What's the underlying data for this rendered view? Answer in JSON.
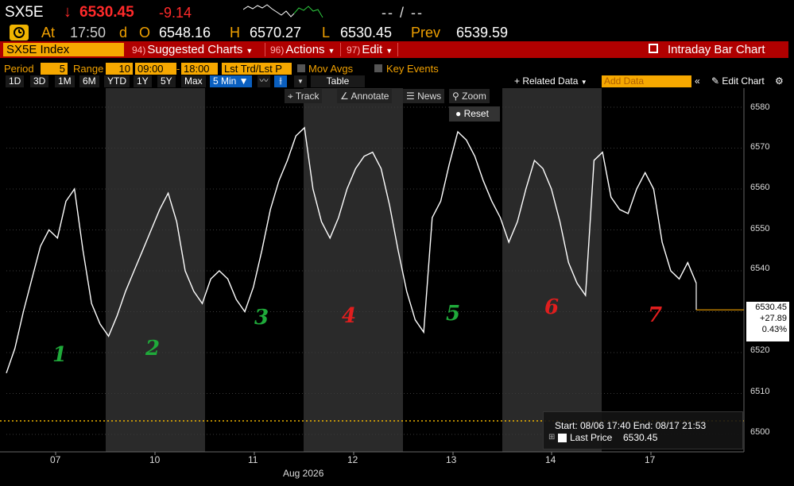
{
  "header": {
    "ticker": "SX5E",
    "arrow": "↓",
    "last_price": "6530.45",
    "net_change": "-9.14",
    "dashes": "-- / --",
    "at_label": "At",
    "time": "17:50",
    "d_label": "d",
    "open_label": "O",
    "open": "6548.16",
    "high_label": "H",
    "high": "6570.27",
    "low_label": "L",
    "low": "6530.45",
    "prev_label": "Prev",
    "prev": "6539.59"
  },
  "command_bar": {
    "security": "SX5E Index",
    "menus": [
      {
        "num": "94)",
        "label": "Suggested Charts"
      },
      {
        "num": "96)",
        "label": "Actions"
      },
      {
        "num": "97)",
        "label": "Edit"
      }
    ],
    "chart_name": "Intraday Bar Chart"
  },
  "options": {
    "period_label": "Period",
    "period_value": "5",
    "range_label": "Range",
    "range_value": "10",
    "start_time": "09:00",
    "end_time": "18:00",
    "lst_trd": "Lst Trd/Lst P",
    "mov_avgs": "Mov Avgs",
    "key_events": "Key Events"
  },
  "range_buttons": [
    "1D",
    "3D",
    "1M",
    "6M",
    "YTD",
    "1Y",
    "5Y",
    "Max"
  ],
  "interval": "5 Min ▼",
  "toolbar": {
    "table": "Table",
    "related": "+ Related Data",
    "add_data_placeholder": "Add Data",
    "edit_chart": "Edit Chart"
  },
  "chart_tools": {
    "track": "Track",
    "annotate": "Annotate",
    "news": "News",
    "zoom": "Zoom",
    "reset": "Reset"
  },
  "chart_data": {
    "type": "line",
    "title": "",
    "ylim": [
      6497,
      6583
    ],
    "yticks": [
      "6580",
      "6570",
      "6560",
      "6550",
      "6540",
      "6530",
      "6520",
      "6510",
      "6500"
    ],
    "xlabels": [
      "07",
      "10",
      "11",
      "12",
      "13",
      "14",
      "17"
    ],
    "month_label": "Aug 2026",
    "last_price_box": [
      "6530.45",
      "+27.89",
      "0.43%"
    ],
    "session_labels": [
      {
        "text": "1",
        "color": "#1faa3a"
      },
      {
        "text": "2",
        "color": "#1faa3a"
      },
      {
        "text": "3",
        "color": "#1faa3a"
      },
      {
        "text": "4",
        "color": "#e01e1e"
      },
      {
        "text": "5",
        "color": "#1faa3a"
      },
      {
        "text": "6",
        "color": "#e01e1e"
      },
      {
        "text": "7",
        "color": "#e01e1e"
      }
    ],
    "series": [
      {
        "values": [
          6515,
          6521,
          6530,
          6538,
          6546,
          6550,
          6548,
          6557,
          6560,
          6545,
          6532,
          6527,
          6524,
          6529,
          6535,
          6540,
          6545,
          6550,
          6555,
          6559,
          6552,
          6540,
          6535,
          6532,
          6538,
          6540,
          6538,
          6533,
          6530,
          6536,
          6545,
          6555,
          6562,
          6567,
          6573,
          6575,
          6560,
          6552,
          6548,
          6553,
          6560,
          6565,
          6568,
          6569,
          6565,
          6556,
          6545,
          6535,
          6528,
          6525,
          6553,
          6557,
          6566,
          6574,
          6572,
          6568,
          6562,
          6557,
          6553,
          6547,
          6552,
          6560,
          6567,
          6565,
          6560,
          6552,
          6542,
          6537,
          6534,
          6567,
          6569,
          6558,
          6555,
          6554,
          6560,
          6564,
          6560,
          6547,
          6540,
          6538,
          6542,
          6537
        ]
      }
    ],
    "legend": {
      "range_text": "Start: 08/06 17:40 End: 08/17 21:53",
      "series_label": "Last Price",
      "series_value": "6530.45"
    },
    "colors": {
      "line": "#ffffff",
      "shade": "#2a2a2a",
      "grid": "#3a3a3a",
      "last_price_line": "#f0a000",
      "dotted": "#f0b400"
    }
  }
}
